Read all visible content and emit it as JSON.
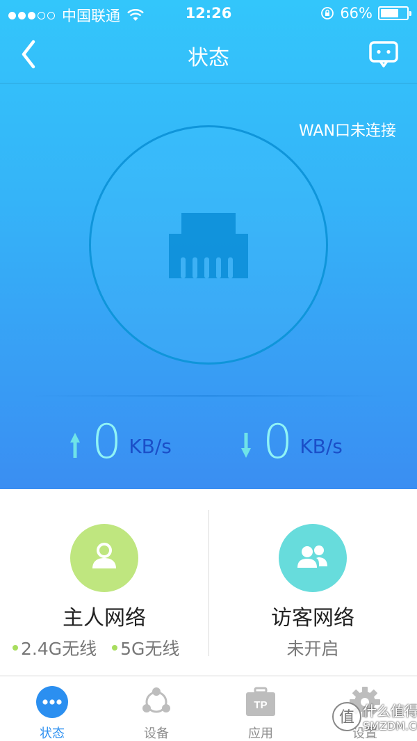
{
  "status_bar": {
    "carrier": "中国联通",
    "time": "12:26",
    "battery": "66%",
    "battery_level": 0.66,
    "signal_bars_filled": 3,
    "signal_bars_total": 5
  },
  "nav": {
    "title": "状态",
    "back_icon": "chevron-left-icon",
    "message_icon": "chat-bubble-icon"
  },
  "wan": {
    "status_text": "WAN口未连接",
    "port_icon": "ethernet-port-icon"
  },
  "speeds": {
    "upload": {
      "value": "0",
      "unit": "KB/s"
    },
    "download": {
      "value": "0",
      "unit": "KB/s"
    }
  },
  "host_network": {
    "title": "主人网络",
    "bands": [
      "2.4G无线",
      "5G无线"
    ]
  },
  "guest_network": {
    "title": "访客网络",
    "status": "未开启"
  },
  "tabs": [
    {
      "label": "状态",
      "icon": "status-dots-icon",
      "active": true
    },
    {
      "label": "设备",
      "icon": "devices-share-icon",
      "active": false
    },
    {
      "label": "应用",
      "icon": "apps-tp-icon",
      "active": false
    },
    {
      "label": "设置",
      "icon": "gear-icon",
      "active": false
    }
  ],
  "watermark": {
    "text_line1": "什么值得买",
    "text_line2": "SMZDM.COM",
    "logo_char": "值"
  },
  "colors": {
    "gradient_top": "#33c6fb",
    "gradient_bottom": "#3a8ef2",
    "speed_value": "#8ff3f6",
    "speed_unit": "#1b4fc8",
    "host_avatar": "#bfe67f",
    "guest_avatar": "#67dcdc",
    "tab_active": "#2b8ff0",
    "tab_inactive": "#8e8e8e"
  }
}
